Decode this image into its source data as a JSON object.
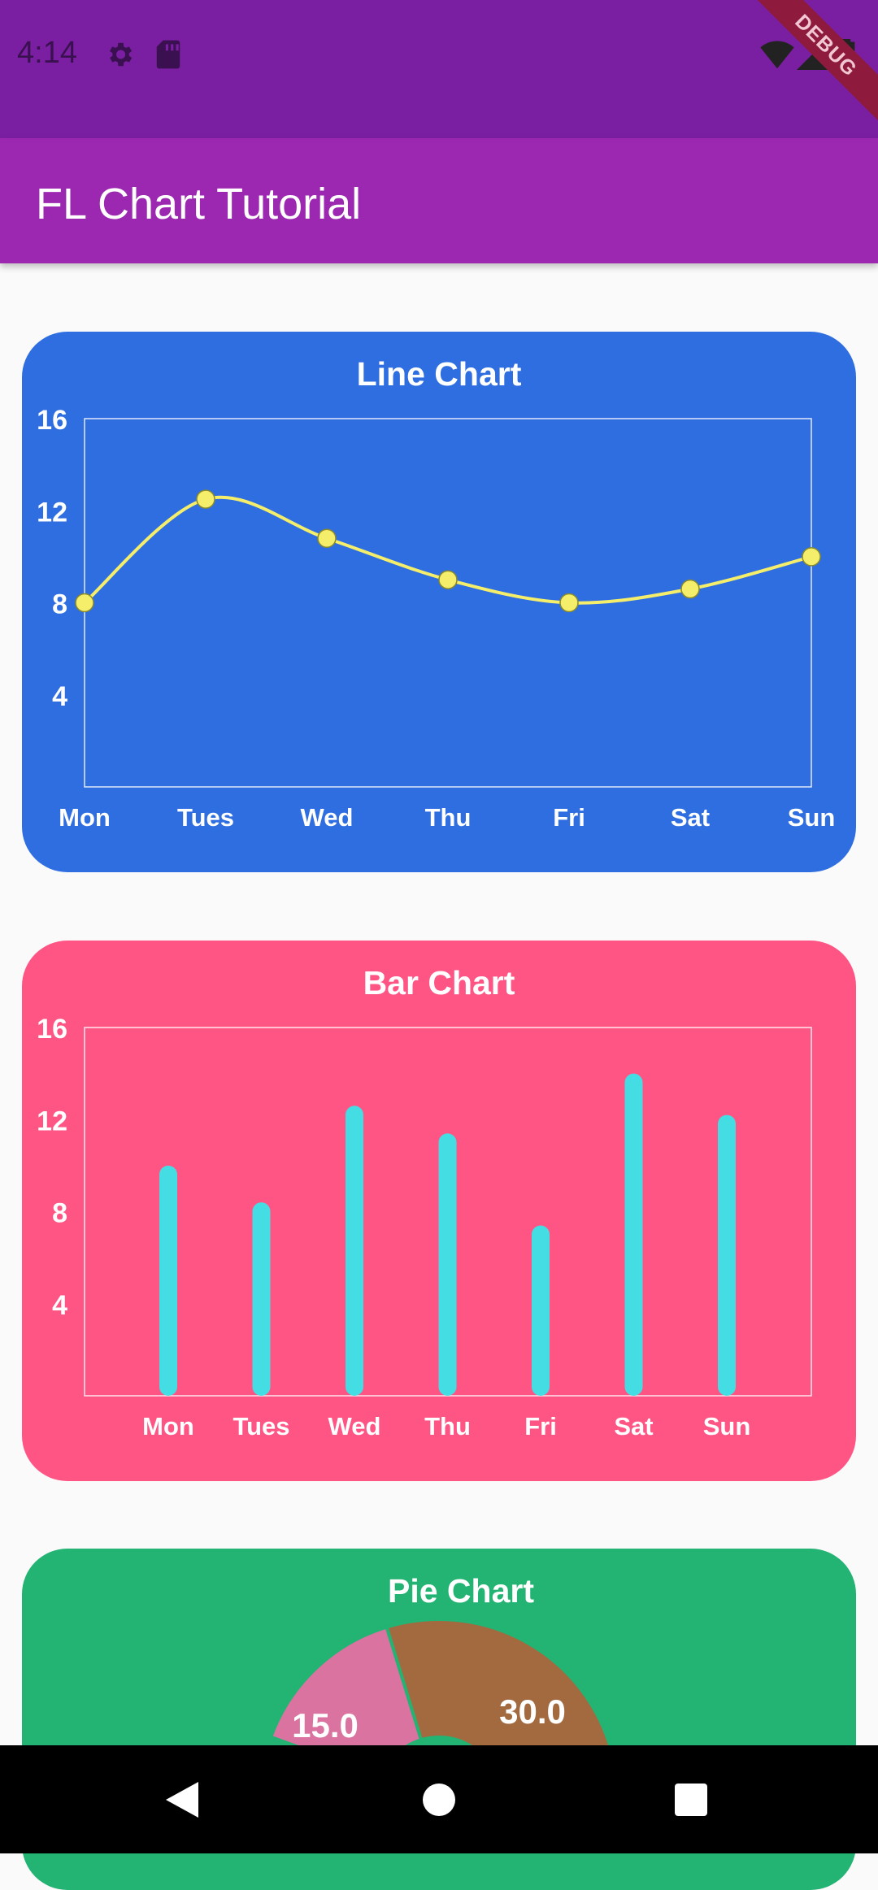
{
  "status_bar": {
    "time": "4:14",
    "left_icons": [
      "gear-icon",
      "sd-card-icon"
    ],
    "right_icons": [
      "wifi-icon",
      "signal-icon",
      "battery-icon"
    ],
    "debug_banner": "DEBUG"
  },
  "app_bar": {
    "title": "FL Chart Tutorial"
  },
  "colors": {
    "status_bar": "#7b1fa2",
    "app_bar": "#9c27b0",
    "line_card": "#2f6ee0",
    "bar_card": "#ff5585",
    "pie_card": "#23b373",
    "line_color": "#f5ee6b",
    "bar_color": "#45dde4",
    "pie_pink": "#da73a0",
    "pie_brown": "#a36a40"
  },
  "line_chart": {
    "title": "Line Chart",
    "chart_data": {
      "type": "line",
      "categories": [
        "Mon",
        "Tues",
        "Wed",
        "Thu",
        "Fri",
        "Sat",
        "Sun"
      ],
      "values": [
        8,
        12.5,
        10.8,
        9,
        8,
        8.6,
        10
      ],
      "ylim": [
        0,
        16
      ],
      "yticks": [
        "4",
        "8",
        "12",
        "16"
      ],
      "grid": false
    }
  },
  "bar_chart": {
    "title": "Bar Chart",
    "chart_data": {
      "type": "bar",
      "categories": [
        "Mon",
        "Tues",
        "Wed",
        "Thu",
        "Fri",
        "Sat",
        "Sun"
      ],
      "values": [
        10,
        8.4,
        12.6,
        11.4,
        7.4,
        14,
        12.2
      ],
      "ylim": [
        0,
        16
      ],
      "yticks": [
        "4",
        "8",
        "12",
        "16"
      ],
      "grid": false
    }
  },
  "pie_chart": {
    "title": "Pie Chart",
    "chart_data": {
      "type": "pie",
      "visible_labels": [
        "15.0",
        "30.0"
      ],
      "slices": [
        {
          "value": 15,
          "label": "15.0",
          "color": "#da73a0"
        },
        {
          "value": 30,
          "label": "30.0",
          "color": "#a36a40"
        }
      ]
    }
  },
  "nav_bar": {
    "icons": [
      "back-icon",
      "home-icon",
      "recents-icon"
    ]
  }
}
